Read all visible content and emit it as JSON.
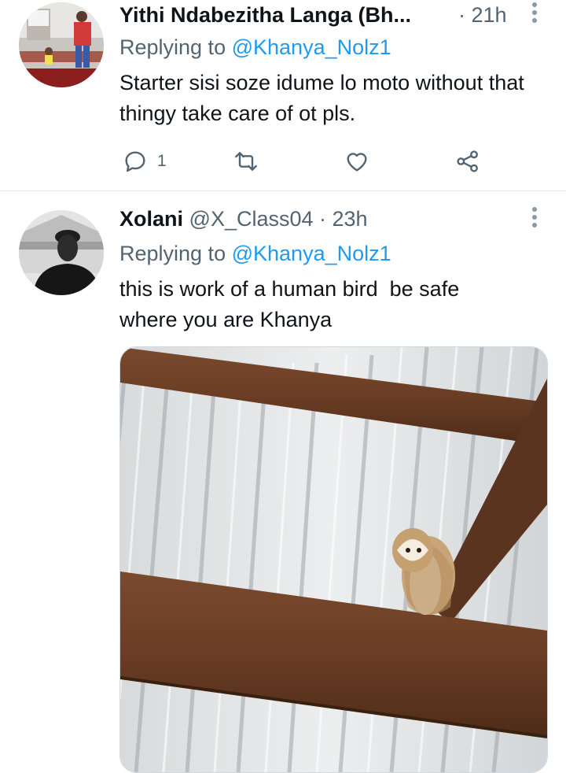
{
  "tweets": [
    {
      "name": "Yithi Ndabezitha Langa (Bh...",
      "handle": "",
      "time": "· 21h",
      "replying_label": "Replying to",
      "replying_handle": "@Khanya_Nolz1",
      "text": "Starter sisi soze idume lo moto without that thingy take care of ot pls.",
      "reply_count": "1"
    },
    {
      "name": "Xolani",
      "handle": "@X_Class04",
      "time": "· 23h",
      "replying_label": "Replying to",
      "replying_handle": "@Khanya_Nolz1",
      "text": "this is work of a human bird  be safe where you are Khanya"
    }
  ],
  "icons": [
    "reply-icon",
    "retweet-icon",
    "like-icon",
    "share-icon",
    "more-icon"
  ],
  "colors": {
    "accent": "#1d9bf0",
    "secondary_text": "#536471",
    "primary_text": "#0f1419"
  }
}
